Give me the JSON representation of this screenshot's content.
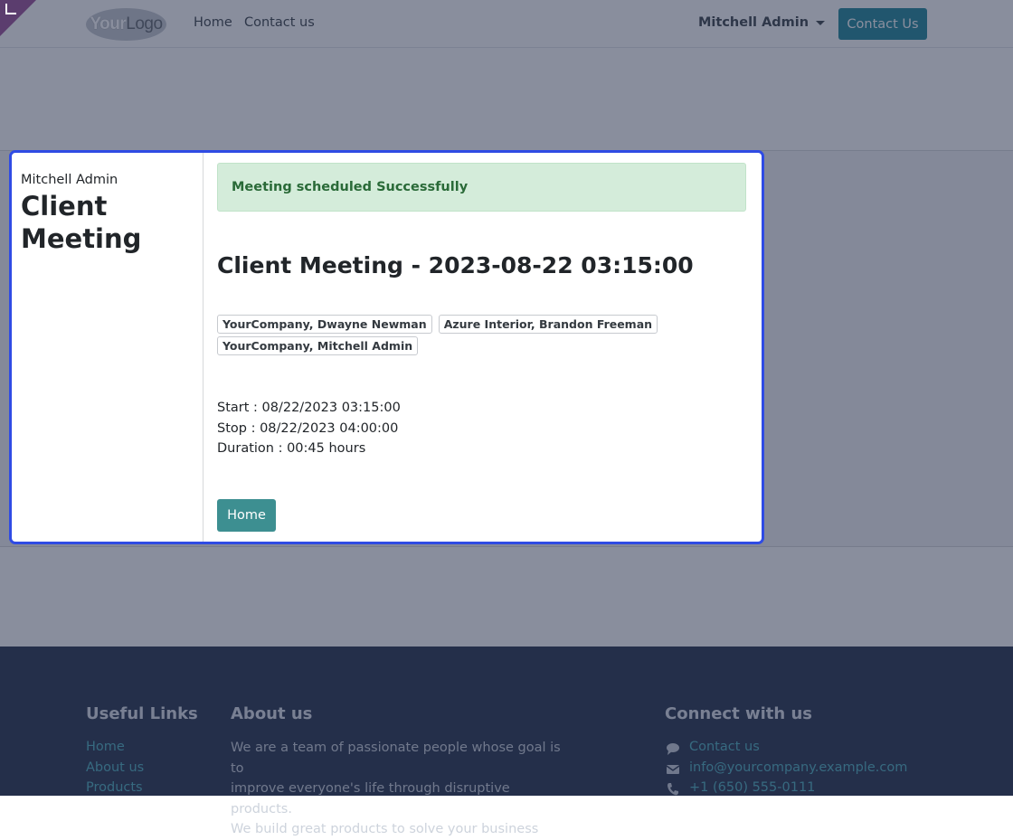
{
  "header": {
    "logo": {
      "part1": "Your",
      "part2": "Logo"
    },
    "nav": [
      {
        "label": "Home"
      },
      {
        "label": "Contact us"
      }
    ],
    "user_menu": "Mitchell Admin",
    "cta_label": "Contact Us"
  },
  "card": {
    "sidebar": {
      "user": "Mitchell Admin",
      "title": "Client Meeting"
    },
    "alert": "Meeting scheduled Successfully",
    "title": "Client Meeting - 2023-08-22 03:15:00",
    "attendees": [
      "YourCompany, Dwayne Newman",
      "Azure Interior, Brandon Freeman",
      "YourCompany, Mitchell Admin"
    ],
    "start": "Start : 08/22/2023 03:15:00",
    "stop": "Stop : 08/22/2023 04:00:00",
    "duration": "Duration : 00:45 hours",
    "home_button": "Home"
  },
  "footer": {
    "useful_links": {
      "title": "Useful Links",
      "items": [
        "Home",
        "About us",
        "Products"
      ]
    },
    "about": {
      "title": "About us",
      "lines": [
        "We are a team of passionate people whose goal is to",
        "improve everyone's life through disruptive products.",
        "We build great products to solve your business"
      ]
    },
    "connect": {
      "title": "Connect with us",
      "items": [
        {
          "icon": "chat-icon",
          "label": "Contact us"
        },
        {
          "icon": "envelope-icon",
          "label": "info@yourcompany.example.com"
        },
        {
          "icon": "phone-icon",
          "label": "+1 (650) 555-0111"
        }
      ]
    }
  },
  "colors": {
    "primary": "#2e8fa0",
    "card_border": "#2f4be4",
    "alert_bg": "#d4ecda",
    "footer_bg": "#354158"
  }
}
